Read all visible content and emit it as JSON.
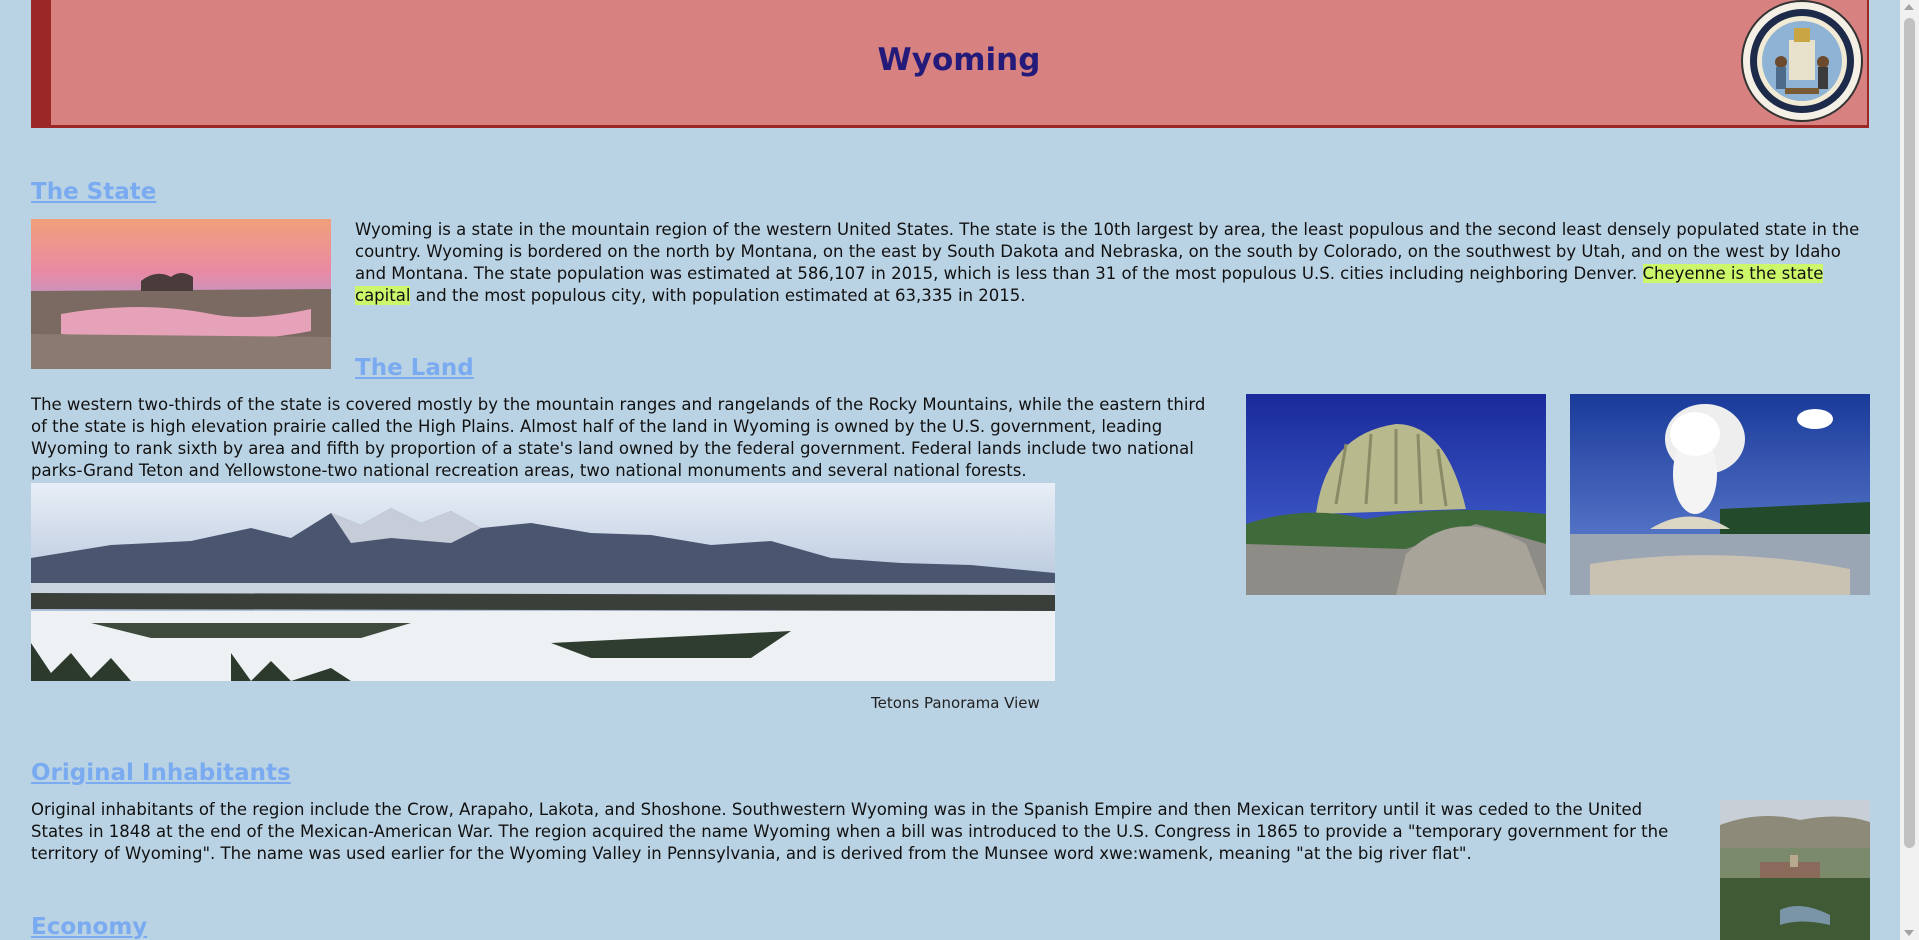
{
  "header": {
    "title": "Wyoming",
    "seal_alt": "Great Seal of the State of Wyoming",
    "seal_text": "GREAT SEAL OF THE STATE OF WYOMING"
  },
  "sections": {
    "state": {
      "title": "The State",
      "text_before": "Wyoming is a state in the mountain region of the western United States. The state is the 10th largest by area, the least populous and the second least densely populated state in the country. Wyoming is bordered on the north by Montana, on the east by South Dakota and Nebraska, on the south by Colorado, on the southwest by Utah, and on the west by Idaho and Montana. The state population was estimated at 586,107 in 2015, which is less than 31 of the most populous U.S. cities including neighboring Denver. ",
      "highlight": "Cheyenne is the state capital",
      "text_after": " and the most populous city, with population estimated at 63,335 in 2015."
    },
    "land": {
      "title": "The Land",
      "text": "The western two-thirds of the state is covered mostly by the mountain ranges and rangelands of the Rocky Mountains, while the eastern third of the state is high elevation prairie called the High Plains. Almost half of the land in Wyoming is owned by the U.S. government, leading Wyoming to rank sixth by area and fifth by proportion of a state's land owned by the federal government. Federal lands include two national parks-Grand Teton and Yellowstone-two national recreation areas, two national monuments and several national forests.",
      "caption": "Tetons Panorama View"
    },
    "inhabitants": {
      "title": "Original Inhabitants",
      "text": "Original inhabitants of the region include the Crow, Arapaho, Lakota, and Shoshone. Southwestern Wyoming was in the Spanish Empire and then Mexican territory until it was ceded to the United States in 1848 at the end of the Mexican-American War. The region acquired the name Wyoming when a bill was introduced to the U.S. Congress in 1865 to provide a \"temporary government for the territory of Wyoming\". The name was used earlier for the Wyoming Valley in Pennsylvania, and is derived from the Munsee word xwe:wamenk, meaning \"at the big river flat\"."
    },
    "economy": {
      "title": "Economy"
    }
  },
  "colors": {
    "background": "#bad3e4",
    "header_bg": "#d78280",
    "header_border": "#9b2826",
    "title": "#241a7a",
    "link": "#7aaaf0",
    "highlight": "#cdf76a"
  }
}
